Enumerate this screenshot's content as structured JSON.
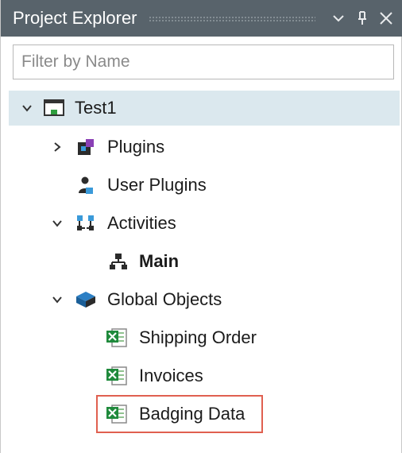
{
  "panel": {
    "title": "Project Explorer"
  },
  "filter": {
    "placeholder": "Filter by Name",
    "value": ""
  },
  "tree": {
    "root": {
      "label": "Test1",
      "expanded": true
    },
    "plugins": {
      "label": "Plugins",
      "expanded": false
    },
    "user_plugins": {
      "label": "User Plugins"
    },
    "activities": {
      "label": "Activities",
      "expanded": true
    },
    "main": {
      "label": "Main"
    },
    "global_objects": {
      "label": "Global Objects",
      "expanded": true
    },
    "shipping_order": {
      "label": "Shipping Order"
    },
    "invoices": {
      "label": "Invoices"
    },
    "badging_data": {
      "label": "Badging Data"
    }
  },
  "colors": {
    "titlebar": "#58636b",
    "selected_row": "#dbe8ee",
    "highlight_border": "#e06050"
  }
}
